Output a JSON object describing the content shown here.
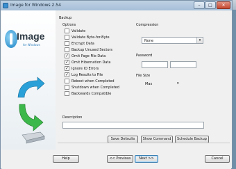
{
  "window": {
    "title": "Image for Windows 2.54",
    "min": "–",
    "max": "□",
    "close": "✕"
  },
  "sidebar": {
    "logo_text": "Image",
    "logo_sub": "for Windows"
  },
  "backup": {
    "group_label": "Backup",
    "options_label": "Options",
    "options": [
      {
        "label": "Validate",
        "checked": false
      },
      {
        "label": "Validate Byte-for-Byte",
        "checked": false
      },
      {
        "label": "Encrypt Data",
        "checked": false
      },
      {
        "label": "Backup Unused Sectors",
        "checked": false
      },
      {
        "label": "Omit Page File Data",
        "checked": true
      },
      {
        "label": "Omit Hibernation Data",
        "checked": true
      },
      {
        "label": "Ignore IO Errors",
        "checked": true
      },
      {
        "label": "Log Results to File",
        "checked": true
      },
      {
        "label": "Reboot when Completed",
        "checked": false
      },
      {
        "label": "Shutdown when Completed",
        "checked": false
      },
      {
        "label": "Backwards Compatible",
        "checked": false
      }
    ],
    "compression_label": "Compression",
    "compression_value": "None",
    "password_label": "Password",
    "password_value": "",
    "password_confirm_value": "",
    "filesize_label": "File Size",
    "filesize_value": "Max",
    "description_label": "Description",
    "description_value": ""
  },
  "actions": {
    "save_defaults": "Save Defaults",
    "show_command": "Show Command",
    "schedule_backup": "Schedule Backup"
  },
  "footer": {
    "help": "Help",
    "previous": "<< Previous",
    "next": "Next >>",
    "cancel": "Cancel"
  },
  "colors": {
    "accent": "#3c7fb1",
    "title_bar": "#a6bfd8"
  }
}
